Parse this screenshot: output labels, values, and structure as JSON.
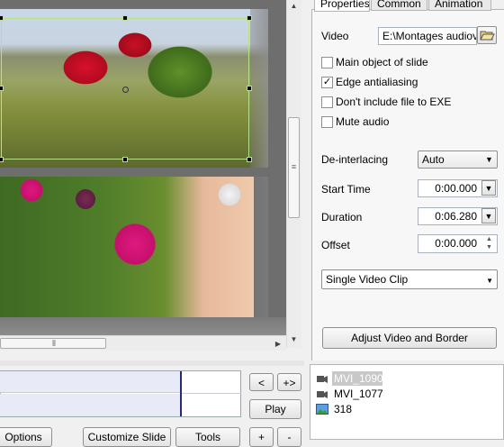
{
  "tabs": [
    "Properties",
    "Common",
    "Animation"
  ],
  "video": {
    "label": "Video",
    "path": "E:\\Montages audiov",
    "browse_icon": "folder-open-icon"
  },
  "checkboxes": [
    {
      "label": "Main object of slide",
      "checked": false
    },
    {
      "label": "Edge antialiasing",
      "checked": true
    },
    {
      "label": "Don't include file to EXE",
      "checked": false
    },
    {
      "label": "Mute audio",
      "checked": false
    }
  ],
  "deinterlacing": {
    "label": "De-interlacing",
    "value": "Auto"
  },
  "start_time": {
    "label": "Start Time",
    "value": "0:00.000"
  },
  "duration": {
    "label": "Duration",
    "value": "0:06.280"
  },
  "offset": {
    "label": "Offset",
    "value": "0:00.000"
  },
  "clip_mode": {
    "value": "Single Video Clip"
  },
  "adjust_button": "Adjust Video and Border",
  "nav": {
    "prev": "<",
    "next": "+>",
    "play": "Play",
    "add": "+",
    "remove": "-"
  },
  "bottom_buttons": [
    "Options",
    "Customize Slide",
    "Tools"
  ],
  "slide_list": [
    {
      "name": "MVI_1090",
      "selected": true,
      "icon": "video-camera-icon"
    },
    {
      "name": "MVI_1077",
      "selected": false,
      "icon": "video-camera-icon"
    },
    {
      "name": "318",
      "selected": false,
      "icon": "image-icon"
    }
  ],
  "colors": {
    "selection_border": "#b8e08a",
    "selected_item_bg": "#c8c8c8",
    "timeline_cursor": "#27287a"
  }
}
